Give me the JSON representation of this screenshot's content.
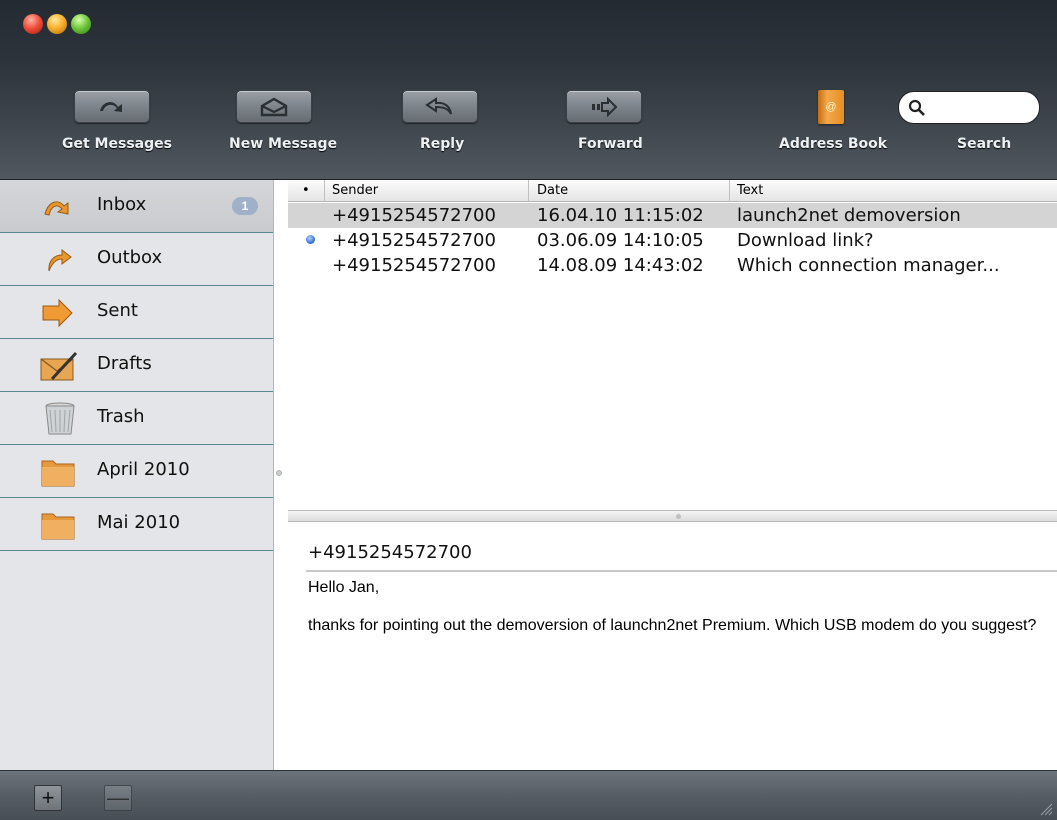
{
  "toolbar": {
    "get_messages": "Get Messages",
    "new_message": "New Message",
    "reply": "Reply",
    "forward": "Forward",
    "address_book": "Address Book",
    "search": "Search",
    "search_value": ""
  },
  "sidebar": {
    "items": [
      {
        "label": "Inbox",
        "icon": "inbox-arrow-icon",
        "badge": "1"
      },
      {
        "label": "Outbox",
        "icon": "outbox-arrow-icon"
      },
      {
        "label": "Sent",
        "icon": "sent-arrow-icon"
      },
      {
        "label": "Drafts",
        "icon": "drafts-envelope-icon"
      },
      {
        "label": "Trash",
        "icon": "trash-bin-icon"
      },
      {
        "label": "April 2010",
        "icon": "folder-icon"
      },
      {
        "label": "Mai 2010",
        "icon": "folder-icon"
      }
    ]
  },
  "list": {
    "columns": {
      "dot": "•",
      "sender": "Sender",
      "date": "Date",
      "text": "Text"
    },
    "rows": [
      {
        "sender": "+4915254572700",
        "date": "16.04.10 11:15:02",
        "text": "launch2net demoversion",
        "unread": false,
        "selected": true
      },
      {
        "sender": "+4915254572700",
        "date": "03.06.09 14:10:05",
        "text": "Download link?",
        "unread": true,
        "selected": false
      },
      {
        "sender": "+4915254572700",
        "date": "14.08.09 14:43:02",
        "text": "Which connection manager...",
        "unread": false,
        "selected": false
      }
    ]
  },
  "preview": {
    "sender": "+4915254572700",
    "greeting": "Hello Jan,",
    "body": "thanks for pointing out the demoversion of launchn2net Premium. Which USB modem do you suggest?"
  },
  "bottombar": {
    "add": "+",
    "remove": "—"
  },
  "colors": {
    "unread_dot": "#3b74d9",
    "badge": "#9fb0c8",
    "sidebar_separator": "#5b8790",
    "selected_row": "#d4d4d4"
  }
}
